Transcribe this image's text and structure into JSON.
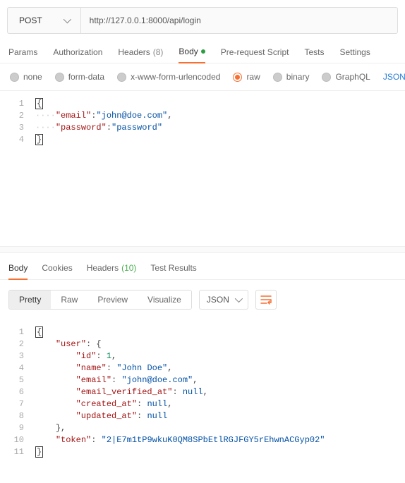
{
  "request": {
    "method": "POST",
    "url": "http://127.0.0.1:8000/api/login"
  },
  "sectionTabs": {
    "params": "Params",
    "auth": "Authorization",
    "headers": "Headers",
    "headersCount": "(8)",
    "body": "Body",
    "prerequest": "Pre-request Script",
    "tests": "Tests",
    "settings": "Settings"
  },
  "bodyTypes": {
    "none": "none",
    "formData": "form-data",
    "xwww": "x-www-form-urlencoded",
    "raw": "raw",
    "binary": "binary",
    "graphql": "GraphQL",
    "json": "JSON"
  },
  "reqBody": {
    "l1_open": "{",
    "dots": "····",
    "emailKey": "\"email\"",
    "emailVal": "\"john@doe.com\"",
    "passKey": "\"password\"",
    "passVal": "\"password\"",
    "l4_close": "}"
  },
  "respTabs": {
    "body": "Body",
    "cookies": "Cookies",
    "headers": "Headers",
    "headersCount": "(10)",
    "testResults": "Test Results"
  },
  "viewControls": {
    "pretty": "Pretty",
    "raw": "Raw",
    "preview": "Preview",
    "visualize": "Visualize",
    "fmt": "JSON"
  },
  "resp": {
    "open": "{",
    "userKey": "\"user\"",
    "idKey": "\"id\"",
    "idVal": "1",
    "nameKey": "\"name\"",
    "nameVal": "\"John Doe\"",
    "emailKey": "\"email\"",
    "emailVal": "\"john@doe.com\"",
    "evKey": "\"email_verified_at\"",
    "nullVal": "null",
    "cKey": "\"created_at\"",
    "uKey": "\"updated_at\"",
    "closeBrace": "}",
    "tokenKey": "\"token\"",
    "tokenVal": "\"2|E7m1tP9wkuK0QM8SPbEtlRGJFGY5rEhwnACGyp02\""
  },
  "lineNums": {
    "1": "1",
    "2": "2",
    "3": "3",
    "4": "4",
    "5": "5",
    "6": "6",
    "7": "7",
    "8": "8",
    "9": "9",
    "10": "10",
    "11": "11"
  }
}
